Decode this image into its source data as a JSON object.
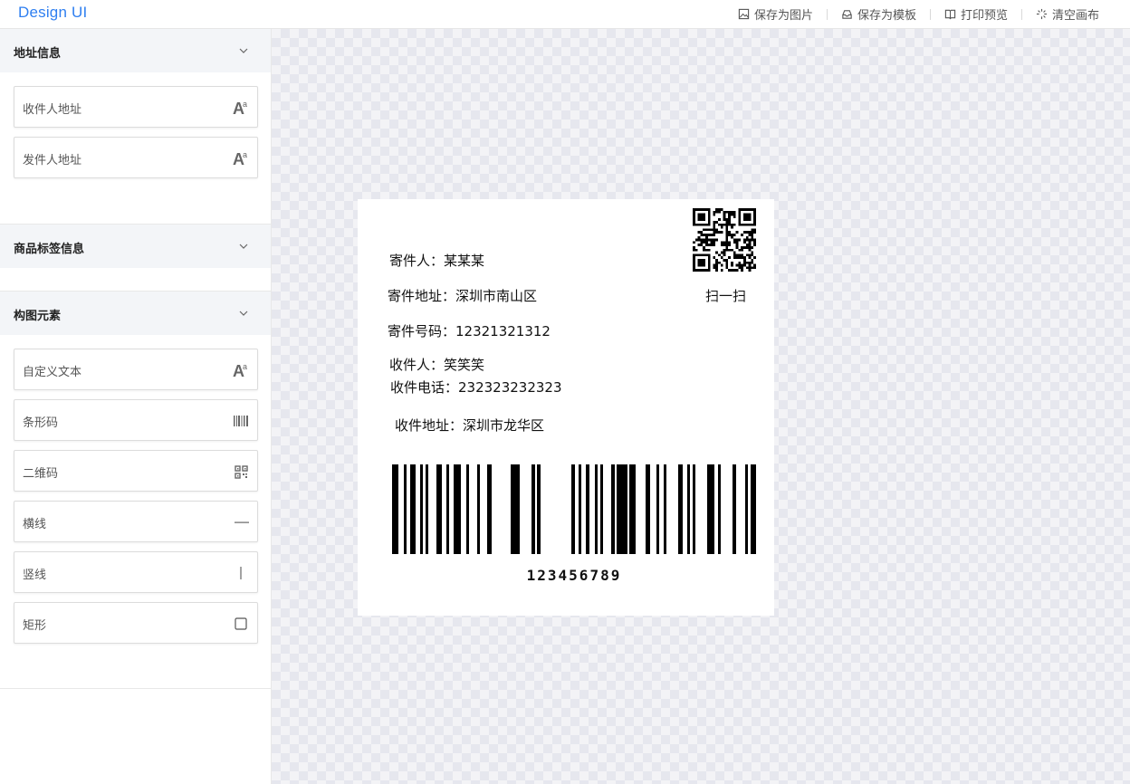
{
  "app": {
    "brand": "Design UI"
  },
  "toolbar": {
    "save_image": "保存为图片",
    "save_template": "保存为模板",
    "print_preview": "打印预览",
    "clear_canvas": "清空画布"
  },
  "sidebar": {
    "address_section": {
      "title": "地址信息",
      "items": [
        {
          "label": "收件人地址",
          "icon": "text-font-icon"
        },
        {
          "label": "发件人地址",
          "icon": "text-font-icon"
        }
      ]
    },
    "product_section": {
      "title": "商品标签信息"
    },
    "compose_section": {
      "title": "构图元素",
      "items": [
        {
          "label": "自定义文本",
          "icon": "text-font-icon"
        },
        {
          "label": "条形码",
          "icon": "barcode-icon"
        },
        {
          "label": "二维码",
          "icon": "qrcode-icon"
        },
        {
          "label": "横线",
          "icon": "horizontal-line-icon"
        },
        {
          "label": "竖线",
          "icon": "vertical-line-icon"
        },
        {
          "label": "矩形",
          "icon": "rectangle-icon"
        }
      ]
    }
  },
  "label": {
    "sender": "寄件人：某某某",
    "sender_address": "寄件地址：深圳市南山区",
    "sender_phone": "寄件号码：12321321312",
    "receiver": "收件人：笑笑笑",
    "receiver_phone": "收件电话：232323232323",
    "receiver_address": "收件地址：深圳市龙华区",
    "qr_caption": "扫一扫",
    "barcode_number": "123456789"
  }
}
